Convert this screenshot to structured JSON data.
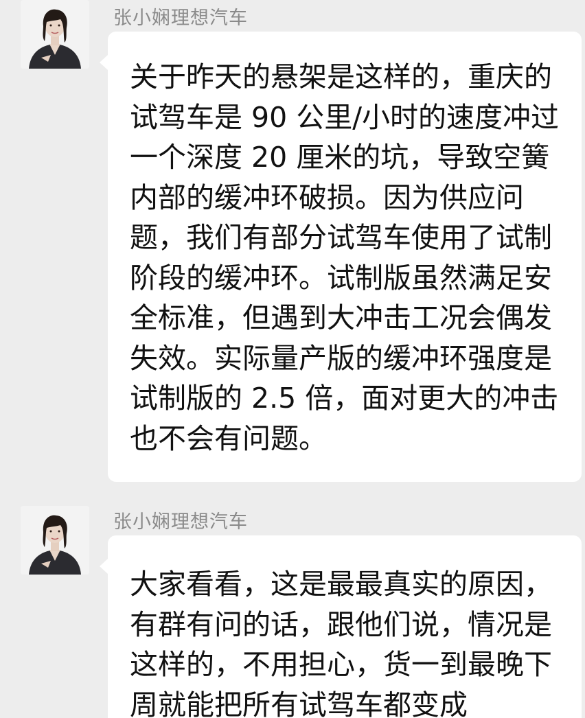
{
  "messages": [
    {
      "sender": "张小娴理想汽车",
      "avatar_icon": "person-portrait-icon",
      "lines": [
        "关于昨天的悬架是这样的，重庆的",
        "试驾车是 90 公里/小时的速度冲过",
        "一个深度 20 厘米的坑，导致空簧",
        "内部的缓冲环破损。因为供应问",
        "题，我们有部分试驾车使用了试制",
        "阶段的缓冲环。试制版虽然满足安",
        "全标准，但遇到大冲击工况会偶发",
        "失效。实际量产版的缓冲环强度是",
        "试制版的 2.5 倍，面对更大的冲击",
        "也不会有问题。"
      ]
    },
    {
      "sender": "张小娴理想汽车",
      "avatar_icon": "person-portrait-icon",
      "lines": [
        "大家看看，这是最最真实的原因，",
        "有群有问的话，跟他们说，情况是",
        "这样的，不用担心，货一到最晚下",
        "周就能把所有试驾车都变成"
      ]
    }
  ],
  "colors": {
    "background": "#ededed",
    "bubble": "#ffffff",
    "sender_text": "#8a8a8a",
    "message_text": "#111111"
  }
}
